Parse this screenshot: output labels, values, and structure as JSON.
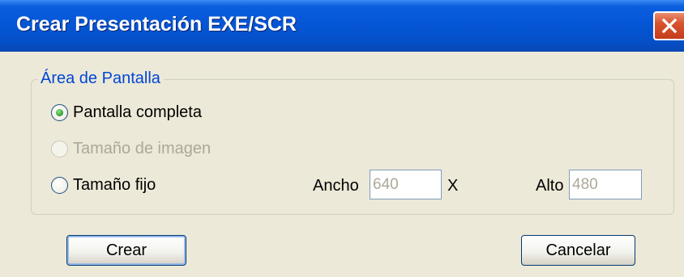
{
  "window": {
    "title": "Crear Presentación EXE/SCR",
    "close_icon": "close-icon"
  },
  "group": {
    "legend": "Área de Pantalla",
    "options": [
      {
        "label": "Pantalla completa",
        "selected": true,
        "enabled": true
      },
      {
        "label": "Tamaño de imagen",
        "selected": false,
        "enabled": false
      },
      {
        "label": "Tamaño fijo",
        "selected": false,
        "enabled": true
      }
    ],
    "ancho_label": "Ancho",
    "ancho_value": "640",
    "x_separator": "X",
    "alto_label": "Alto",
    "alto_value": "480"
  },
  "buttons": {
    "create": "Crear",
    "cancel": "Cancelar"
  },
  "colors": {
    "titlebar": "#0556d6",
    "legend": "#0046d5",
    "dialog_bg": "#ece9d8",
    "close": "#d8532e"
  }
}
